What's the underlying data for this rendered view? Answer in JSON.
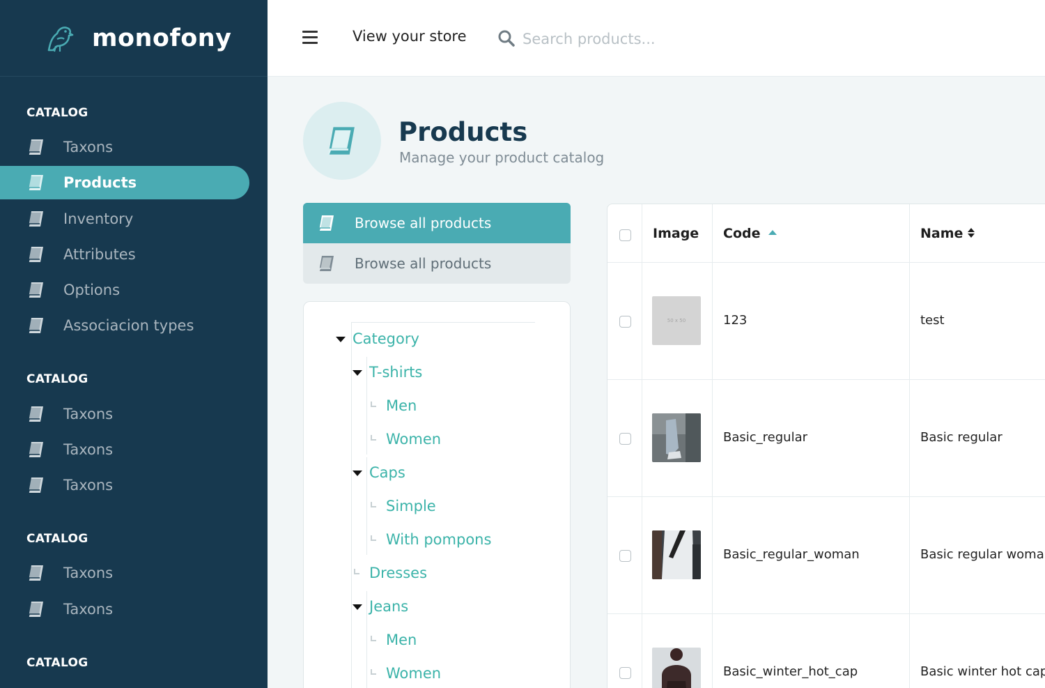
{
  "brand": {
    "name": "monofony"
  },
  "sidebar": {
    "sections": [
      {
        "title": "CATALOG",
        "items": [
          "Taxons",
          "Products",
          "Inventory",
          "Attributes",
          "Options",
          "Associacion types"
        ]
      },
      {
        "title": "CATALOG",
        "items": [
          "Taxons",
          "Taxons",
          "Taxons"
        ]
      },
      {
        "title": "CATALOG",
        "items": [
          "Taxons",
          "Taxons"
        ]
      },
      {
        "title": "CATALOG",
        "items": []
      }
    ],
    "active_item": "Products"
  },
  "topbar": {
    "view_store_label": "View your store",
    "search_placeholder": "Search products..."
  },
  "header": {
    "title": "Products",
    "subtitle": "Manage your product catalog"
  },
  "browse": {
    "items": [
      "Browse all products",
      "Browse all products"
    ]
  },
  "tree": {
    "root": "Category",
    "nodes": [
      "T-shirts",
      "Men",
      "Women",
      "Caps",
      "Simple",
      "With pompons",
      "Dresses",
      "Jeans",
      "Men",
      "Women"
    ]
  },
  "table": {
    "columns": [
      "Image",
      "Code",
      "Name"
    ],
    "thumb_placeholder_text": "50 x 50",
    "rows": [
      {
        "code": "123",
        "name": "test"
      },
      {
        "code": "Basic_regular",
        "name": "Basic regular"
      },
      {
        "code": "Basic_regular_woman",
        "name": "Basic regular woman"
      },
      {
        "code": "Basic_winter_hot_cap",
        "name": "Basic winter hot cap"
      }
    ]
  },
  "colors": {
    "sidebar_bg": "#17394f",
    "accent": "#4aabb3",
    "tree_link": "#3bb3a9",
    "page_bg": "#f2f6f7"
  }
}
